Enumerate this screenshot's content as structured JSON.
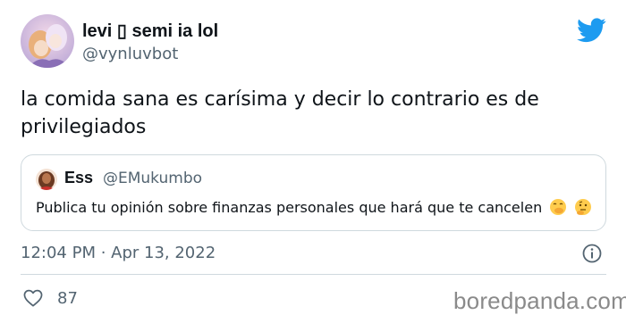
{
  "tweet": {
    "author": {
      "display_name": "levi ▯ semi ia lol",
      "handle": "@vynluvbot"
    },
    "text": "la comida sana es carísima y decir lo contrario es de privilegiados",
    "quoted": {
      "display_name": "Ess",
      "handle": "@EMukumbo",
      "text": "Publica tu opinión sobre finanzas personales que hará que te cancelen",
      "emojis": [
        "face-with-hand-over-mouth-emoji",
        "thinking-face-emoji"
      ]
    },
    "timestamp": "12:04 PM · Apr 13, 2022",
    "likes": "87"
  },
  "icons": {
    "brand": "twitter-bird-icon",
    "info": "info-icon",
    "like": "heart-icon"
  },
  "colors": {
    "twitter_blue": "#1d9bf0",
    "text": "#0f1419",
    "secondary_text": "#536471",
    "border": "#cfd9de"
  },
  "watermark": "boredpanda.com"
}
